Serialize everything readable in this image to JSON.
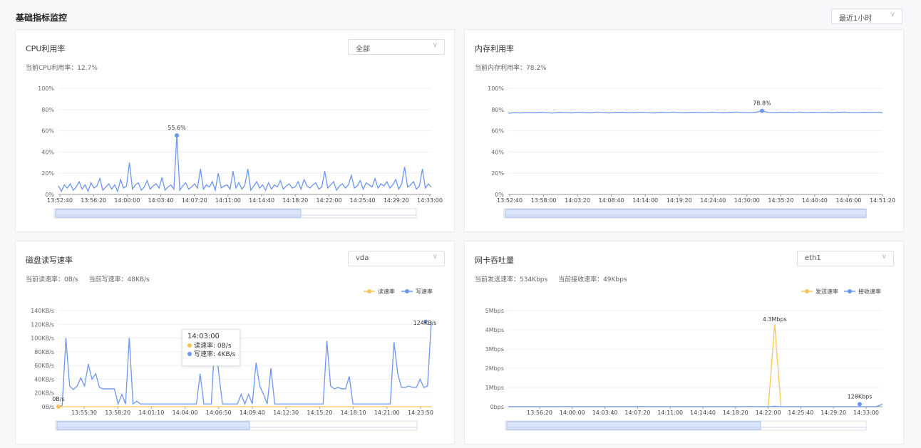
{
  "page": {
    "title": "基础指标监控",
    "range_select": "最近1小时"
  },
  "colors": {
    "blue": "#6e95f0",
    "orange": "#f8c555",
    "grid": "#eef0f4"
  },
  "cpu": {
    "title": "CPU利用率",
    "select": "全部",
    "current_label": "当前CPU利用率：12.7%",
    "chart_data": {
      "type": "line",
      "yticks": [
        "100%",
        "80%",
        "60%",
        "40%",
        "20%",
        "0%"
      ],
      "ylim": [
        0,
        100
      ],
      "xticks": [
        "13:52:40",
        "13:56:20",
        "14:00:00",
        "14:03:40",
        "14:07:20",
        "14:11:00",
        "14:14:40",
        "14:18:20",
        "14:22:00",
        "14:25:40",
        "14:29:20",
        "14:33:00"
      ],
      "annotation": "55.6%",
      "peak": {
        "x": "14:04",
        "y": 55.6
      },
      "series": [
        {
          "values": [
            8,
            3,
            9,
            6,
            10,
            4,
            7,
            12,
            5,
            9,
            3,
            11,
            6,
            8,
            15,
            4,
            7,
            10,
            5,
            9,
            3,
            14,
            6,
            8,
            30,
            5,
            9,
            11,
            4,
            7,
            13,
            5,
            8,
            10,
            6,
            16,
            4,
            7,
            9,
            5,
            55.6,
            4,
            8,
            11,
            5,
            7,
            10,
            6,
            24,
            5,
            9,
            7,
            12,
            4,
            20,
            6,
            8,
            9,
            5,
            22,
            6,
            11,
            5,
            9,
            24,
            4,
            8,
            12,
            6,
            9,
            4,
            11,
            5,
            9,
            7,
            13,
            5,
            8,
            10,
            6,
            7,
            12,
            5,
            14,
            8,
            6,
            9,
            11,
            5,
            7,
            22,
            6,
            9,
            12,
            4,
            8,
            10,
            6,
            9,
            18,
            6,
            8,
            13,
            5,
            11,
            9,
            7,
            15,
            6,
            10,
            8,
            12,
            6,
            9,
            14,
            5,
            10,
            26,
            7,
            9,
            12,
            5,
            8,
            24,
            6,
            10,
            7
          ]
        }
      ]
    }
  },
  "memory": {
    "title": "内存利用率",
    "current_label": "当前内存利用率：78.2%",
    "chart_data": {
      "type": "line",
      "yticks": [
        "100%",
        "80%",
        "60%",
        "40%",
        "20%",
        "0%"
      ],
      "ylim": [
        0,
        100
      ],
      "xticks": [
        "13:52:40",
        "13:58:00",
        "14:03:20",
        "14:08:40",
        "14:14:00",
        "14:19:20",
        "14:24:40",
        "14:30:00",
        "14:35:20",
        "14:40:40",
        "14:46:00",
        "14:51:20"
      ],
      "annotation": "78.8%",
      "peak": {
        "x": "14:31",
        "y": 78.8
      },
      "series": [
        {
          "values": [
            76.5,
            77,
            76.8,
            77.2,
            76.9,
            77.4,
            77,
            76.7,
            77.3,
            77.1,
            76.8,
            77.5,
            77.2,
            76.9,
            77.6,
            77.1,
            76.8,
            77.3,
            77.4,
            76.9,
            77.2,
            77.5,
            77,
            76.8,
            77.3,
            77.1,
            77.6,
            77,
            76.9,
            77.4,
            77.2,
            77,
            77.5,
            77.1,
            76.9,
            77.3,
            77.6,
            77.2,
            77,
            77.4,
            78.8,
            77.2,
            77,
            77.5,
            77.3,
            77.1,
            77.6,
            77,
            77.4,
            77.2,
            77.5,
            76.9,
            77.3,
            77.6,
            77.1,
            77,
            77.4,
            77.2,
            77.5,
            77
          ]
        }
      ]
    }
  },
  "disk": {
    "title": "磁盘读写速率",
    "select": "vda",
    "current_read": "当前读速率：0B/s",
    "current_write": "当前写速率：48KB/s",
    "legend_read": "读速率",
    "legend_write": "写速率",
    "tooltip": {
      "time": "14:03:00",
      "read": "读速率: 0B/s",
      "write": "写速率: 4KB/s"
    },
    "chart_data": {
      "type": "line",
      "yticks": [
        "140KB/s",
        "120KB/s",
        "100KB/s",
        "80KB/s",
        "60KB/s",
        "40KB/s",
        "20KB/s",
        "0B/s"
      ],
      "ylim": [
        0,
        140
      ],
      "xticks": [
        "13:55:30",
        "13:58:20",
        "14:01:10",
        "14:04:00",
        "14:06:50",
        "14:09:40",
        "14:12:30",
        "14:15:20",
        "14:18:10",
        "14:21:00",
        "14:23:50"
      ],
      "annotation_start": "0B/s",
      "annotation_end": "124KB/s",
      "series": [
        {
          "name": "读速率",
          "values": [
            0,
            0,
            0,
            0,
            0,
            0,
            0,
            0,
            0,
            0,
            0,
            0,
            0,
            0,
            0,
            0,
            0,
            0,
            0,
            0,
            0,
            0,
            0,
            0,
            0,
            0,
            0,
            0,
            0,
            0,
            0,
            0,
            0,
            0,
            0,
            0,
            0,
            0,
            0,
            0,
            0,
            0,
            0,
            0,
            0,
            0,
            0,
            0,
            0,
            0,
            0,
            0,
            0,
            0,
            0,
            0,
            0,
            0,
            0,
            0,
            0,
            0,
            0,
            0,
            0,
            0,
            0,
            0,
            0,
            0,
            0,
            0,
            0,
            0,
            0,
            0,
            0,
            0,
            0,
            0
          ]
        },
        {
          "name": "写速率",
          "values": [
            0,
            2,
            100,
            30,
            25,
            30,
            42,
            30,
            62,
            40,
            48,
            28,
            26,
            26,
            26,
            26,
            4,
            18,
            4,
            100,
            4,
            8,
            4,
            4,
            4,
            4,
            4,
            4,
            4,
            4,
            4,
            4,
            4,
            4,
            4,
            4,
            4,
            4,
            48,
            4,
            4,
            4,
            102,
            48,
            4,
            4,
            4,
            4,
            4,
            18,
            4,
            18,
            4,
            64,
            30,
            18,
            4,
            56,
            4,
            4,
            4,
            4,
            4,
            4,
            4,
            4,
            4,
            4,
            4,
            4,
            4,
            4,
            96,
            30,
            26,
            28,
            26,
            26,
            44,
            4,
            4,
            4,
            4,
            4,
            4,
            4,
            4,
            4,
            4,
            4,
            94,
            48,
            28,
            28,
            30,
            28,
            28,
            40,
            28,
            30,
            124
          ]
        }
      ]
    }
  },
  "network": {
    "title": "网卡吞吐量",
    "select": "eth1",
    "current_send": "当前发送速率：534Kbps",
    "current_recv": "当前接收速率：49Kbps",
    "legend_send": "发送速率",
    "legend_recv": "接收速率",
    "chart_data": {
      "type": "line",
      "yticks": [
        "5Mbps",
        "4Mbps",
        "3Mbps",
        "2Mbps",
        "1Mbps",
        "0bps"
      ],
      "ylim": [
        0,
        5
      ],
      "xticks": [
        "13:56:20",
        "14:00:00",
        "14:03:40",
        "14:07:20",
        "14:11:00",
        "14:14:40",
        "14:18:20",
        "14:22:00",
        "14:25:40",
        "14:29:20",
        "14:33:00"
      ],
      "annotation_peak": "4.3Mbps",
      "annotation_end": "128Kbps",
      "peak": {
        "x": "14:21:40",
        "y": 4.3
      },
      "end_value": 0.128,
      "series": [
        {
          "name": "发送速率",
          "values": [
            0,
            0,
            0,
            0,
            0,
            0,
            0,
            0,
            0,
            0,
            0,
            0,
            0,
            0,
            0,
            0,
            0,
            0,
            0,
            0,
            0,
            0,
            0,
            0,
            0,
            0,
            0,
            0,
            0,
            0,
            0,
            0,
            0,
            0,
            0,
            0,
            0,
            0,
            0,
            0,
            0,
            0,
            4.3,
            0,
            0,
            0,
            0,
            0,
            0,
            0,
            0,
            0,
            0,
            0,
            0,
            0,
            0,
            0,
            0,
            0.128
          ]
        },
        {
          "name": "接收速率",
          "values": [
            0,
            0,
            0,
            0,
            0,
            0,
            0,
            0,
            0,
            0.01,
            0,
            0,
            0,
            0,
            0,
            0,
            0,
            0,
            0,
            0,
            0,
            0.01,
            0,
            0,
            0,
            0,
            0,
            0,
            0,
            0,
            0,
            0,
            0,
            0,
            0,
            0,
            0,
            0,
            0.01,
            0,
            0,
            0,
            0.02,
            0,
            0,
            0,
            0,
            0,
            0,
            0,
            0,
            0,
            0,
            0,
            0,
            0,
            0,
            0,
            0,
            0.128
          ]
        }
      ]
    }
  }
}
